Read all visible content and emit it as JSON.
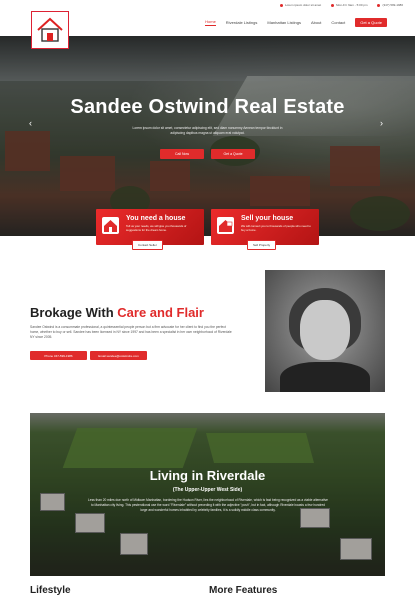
{
  "topbar": {
    "address": "Lorem ipsum dolor sit amet",
    "hours": "Mon-Fri: 9am - 5:00 pm",
    "phone": "(347) 599-1986"
  },
  "nav": {
    "items": [
      "Home",
      "Riverdale Listings",
      "Manhattan Listings",
      "About",
      "Contact"
    ],
    "active": "Home",
    "cta": "Get a Quote"
  },
  "hero": {
    "title": "Sandee Ostwind Real Estate",
    "lead": "Lorem ipsum dolor sit amet, consectetur adipiscing elit, sed diam nonummy Aenean tempor tincidunt in adipiscing dapibus magna ut aliquam erat volutpat.",
    "button_left": "Call Now",
    "button_right": "Get a Quote"
  },
  "cards": [
    {
      "title": "You need a house",
      "text": "Tell us your needs, we will give you thousands of suggestions for the dream home.",
      "button": "Contact Seller"
    },
    {
      "title": "Sell your house",
      "text": "We will connect you to thousands of people who need to buy a home.",
      "button": "Sell Property"
    }
  ],
  "about": {
    "title_plain": "Brokage With ",
    "title_accent": "Care and Flair",
    "text": "Sandee Ostwind is a consummate professional, a quintessential people person but a firm advocate for her client to find you the perfect home, whether to buy or sell. Sandee has been licensed in NY since 1997 and has been a specialist in her own neighborhood of Riverdale NY since 2005.",
    "phone_button": "Phone 347-599-1986",
    "email_button": "Email sandee@ostwindre.com"
  },
  "living": {
    "title": "Living in Riverdale",
    "subtitle": "(The Upper-Upper West Side)",
    "text": "Less than 20 miles due north of Midtown Manhattan, bordering the Hudson River, lies the neighborhood of Riverdale, which is fast being recognized as a viable alternative to Manhattan city living. This pesterotional use the word \"Riverdale\" without preceding it with the adjective \"posh\", but in fact, although Riverdale boasts a few hundred large and wonderful homes inhabited by celebrity families, it is a solidly middle class community."
  },
  "sections": {
    "left": "Lifestyle",
    "right": "More Features"
  },
  "colors": {
    "accent": "#e02b2b"
  },
  "icons": {
    "prev": "chevron-left-icon",
    "next": "chevron-right-icon"
  }
}
